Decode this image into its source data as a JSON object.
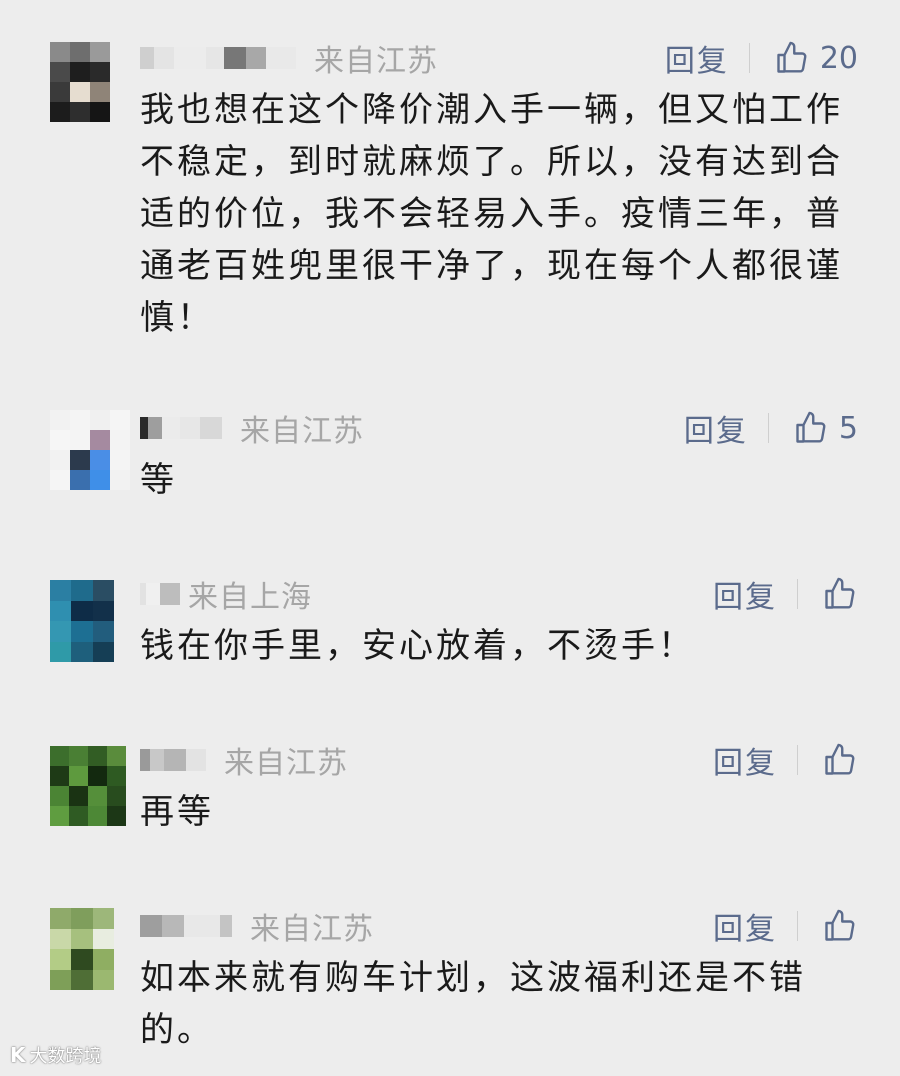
{
  "comments": [
    {
      "location": "来自江苏",
      "reply_label": "回复",
      "like_count": "20",
      "text": "我也想在这个降价潮入手一辆，但又怕工作不稳定，到时就麻烦了。所以，没有达到合适的价位，我不会轻易入手。疫情三年，普通老百姓兜里很干净了，现在每个人都很谨慎！"
    },
    {
      "location": "来自江苏",
      "reply_label": "回复",
      "like_count": "5",
      "text": "等"
    },
    {
      "location": "来自上海",
      "reply_label": "回复",
      "like_count": "",
      "text": "钱在你手里，安心放着，不烫手！"
    },
    {
      "location": "来自江苏",
      "reply_label": "回复",
      "like_count": "",
      "text": "再等"
    },
    {
      "location": "来自江苏",
      "reply_label": "回复",
      "like_count": "",
      "text": "如本来就有购车计划，这波福利还是不错的。"
    }
  ],
  "icons": {
    "like": "thumbs-up-outline-icon"
  },
  "colors": {
    "background": "#ededed",
    "text": "#1a1a1a",
    "location": "#a6a6a6",
    "action": "#5b6b8c"
  },
  "watermark": {
    "logo": "K",
    "text": "大数跨境"
  }
}
